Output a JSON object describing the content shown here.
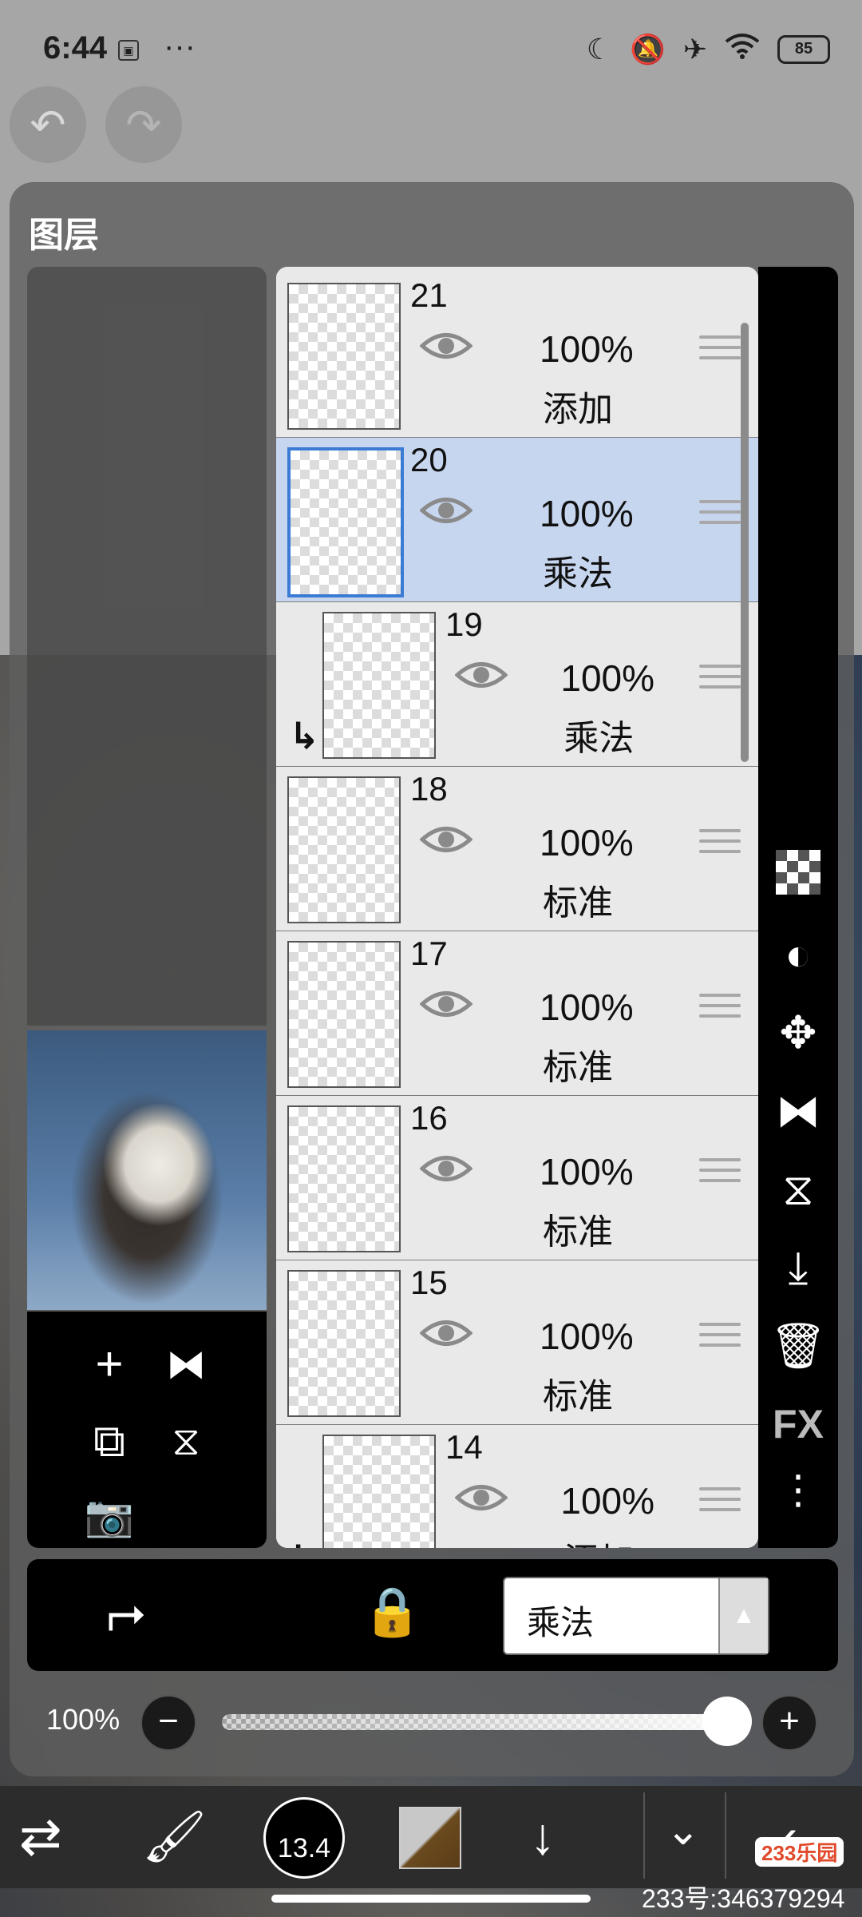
{
  "status_bar": {
    "time": "6:44",
    "more": "···",
    "battery": "85",
    "icons": [
      "moon-icon",
      "mute-icon",
      "airplane-icon",
      "wifi-icon"
    ]
  },
  "top_buttons": [
    "undo-icon",
    "redo-icon"
  ],
  "panel": {
    "title": "图层"
  },
  "layers": [
    {
      "number": "21",
      "opacity": "100%",
      "blend": "添加",
      "selected": false,
      "clipped": false
    },
    {
      "number": "20",
      "opacity": "100%",
      "blend": "乘法",
      "selected": true,
      "clipped": false
    },
    {
      "number": "19",
      "opacity": "100%",
      "blend": "乘法",
      "selected": false,
      "clipped": true
    },
    {
      "number": "18",
      "opacity": "100%",
      "blend": "标准",
      "selected": false,
      "clipped": false
    },
    {
      "number": "17",
      "opacity": "100%",
      "blend": "标准",
      "selected": false,
      "clipped": false
    },
    {
      "number": "16",
      "opacity": "100%",
      "blend": "标准",
      "selected": false,
      "clipped": false
    },
    {
      "number": "15",
      "opacity": "100%",
      "blend": "标准",
      "selected": false,
      "clipped": false
    },
    {
      "number": "14",
      "opacity": "100%",
      "blend": "添加",
      "selected": false,
      "clipped": true
    }
  ],
  "right_tools": {
    "fx_label": "FX"
  },
  "blend_bar": {
    "mode": "乘法"
  },
  "opacity_row": {
    "value": "100%",
    "minus": "−",
    "plus": "+",
    "slider_level": 1.0
  },
  "toolbar": {
    "brush_size": "13.4",
    "swatch_colors": [
      "#c8c8c8",
      "#5a3c18"
    ]
  },
  "watermark": {
    "badge": "233乐园",
    "id": "233号:346379294"
  }
}
